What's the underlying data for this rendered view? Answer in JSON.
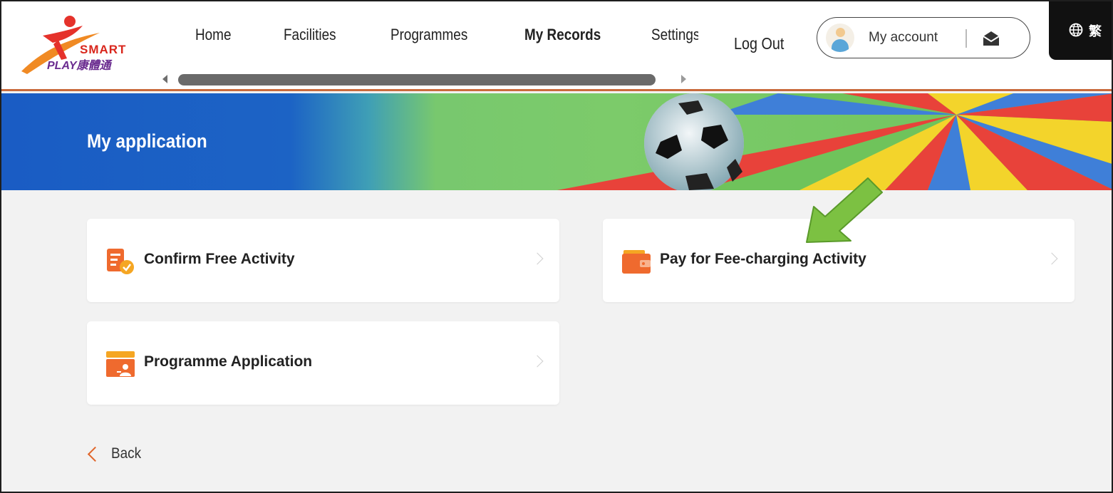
{
  "header": {
    "logo": {
      "icon": "smartplay-logo-icon",
      "word_smart": "SMART",
      "word_play": "PLAY康體通"
    },
    "nav": [
      {
        "label": "Home",
        "active": false
      },
      {
        "label": "Facilities",
        "active": false
      },
      {
        "label": "Programmes",
        "active": false
      },
      {
        "label": "My Records",
        "active": true
      },
      {
        "label": "Settings",
        "active": false
      }
    ],
    "logout_label": "Log Out",
    "account": {
      "label": "My account",
      "avatar_icon": "user-avatar-icon",
      "mail_icon": "mail-icon"
    },
    "language": {
      "icon": "globe-icon",
      "label": "繁"
    }
  },
  "banner": {
    "title": "My application"
  },
  "cards": [
    {
      "label": "Confirm Free Activity",
      "icon": "confirm-list-icon"
    },
    {
      "label": "Pay for Fee-charging Activity",
      "icon": "wallet-icon"
    },
    {
      "label": "Programme Application",
      "icon": "programme-application-icon"
    }
  ],
  "back_label": "Back",
  "colors": {
    "accent_orange": "#e0662b",
    "banner_blue": "#1a5cc4",
    "callout_green": "#7cc142"
  }
}
